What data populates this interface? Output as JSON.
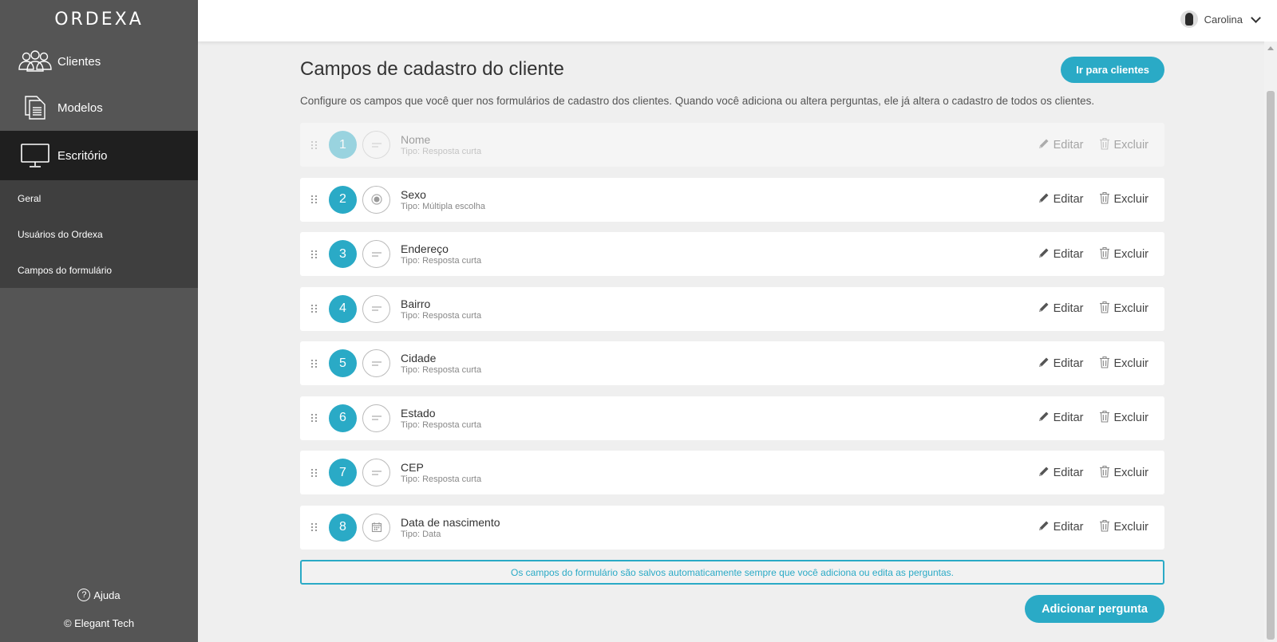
{
  "brand": {
    "logo": "ORDEXA"
  },
  "sidebar": {
    "nav": [
      {
        "label": "Clientes",
        "icon": "users-icon"
      },
      {
        "label": "Modelos",
        "icon": "documents-icon"
      },
      {
        "label": "Escritório",
        "icon": "monitor-icon"
      }
    ],
    "submenu": [
      {
        "label": "Geral"
      },
      {
        "label": "Usuários do Ordexa"
      },
      {
        "label": "Campos do formulário"
      }
    ],
    "help_label": "Ajuda",
    "copyright": "© Elegant Tech"
  },
  "topbar": {
    "user_name": "Carolina"
  },
  "main": {
    "title": "Campos de cadastro do cliente",
    "go_clients_label": "Ir para clientes",
    "description": "Configure os campos que você quer nos formulários de cadastro dos clientes. Quando você adiciona ou altera perguntas, ele já altera o cadastro de todos os clientes.",
    "edit_label": "Editar",
    "delete_label": "Excluir",
    "fields": [
      {
        "number": "1",
        "name": "Nome",
        "type": "Tipo: Resposta curta",
        "icon": "short-answer-icon",
        "disabled": true
      },
      {
        "number": "2",
        "name": "Sexo",
        "type": "Tipo: Múltipla escolha",
        "icon": "radio-icon",
        "disabled": false
      },
      {
        "number": "3",
        "name": "Endereço",
        "type": "Tipo: Resposta curta",
        "icon": "short-answer-icon",
        "disabled": false
      },
      {
        "number": "4",
        "name": "Bairro",
        "type": "Tipo: Resposta curta",
        "icon": "short-answer-icon",
        "disabled": false
      },
      {
        "number": "5",
        "name": "Cidade",
        "type": "Tipo: Resposta curta",
        "icon": "short-answer-icon",
        "disabled": false
      },
      {
        "number": "6",
        "name": "Estado",
        "type": "Tipo: Resposta curta",
        "icon": "short-answer-icon",
        "disabled": false
      },
      {
        "number": "7",
        "name": "CEP",
        "type": "Tipo: Resposta curta",
        "icon": "short-answer-icon",
        "disabled": false
      },
      {
        "number": "8",
        "name": "Data de nascimento",
        "type": "Tipo: Data",
        "icon": "calendar-icon",
        "disabled": false
      }
    ],
    "notice": "Os campos do formulário são salvos automaticamente sempre que você adiciona ou edita as perguntas.",
    "add_label": "Adicionar pergunta"
  },
  "colors": {
    "accent": "#2aaac6",
    "sidebar": "#555555",
    "sidebar_active": "#1f1f1f"
  }
}
